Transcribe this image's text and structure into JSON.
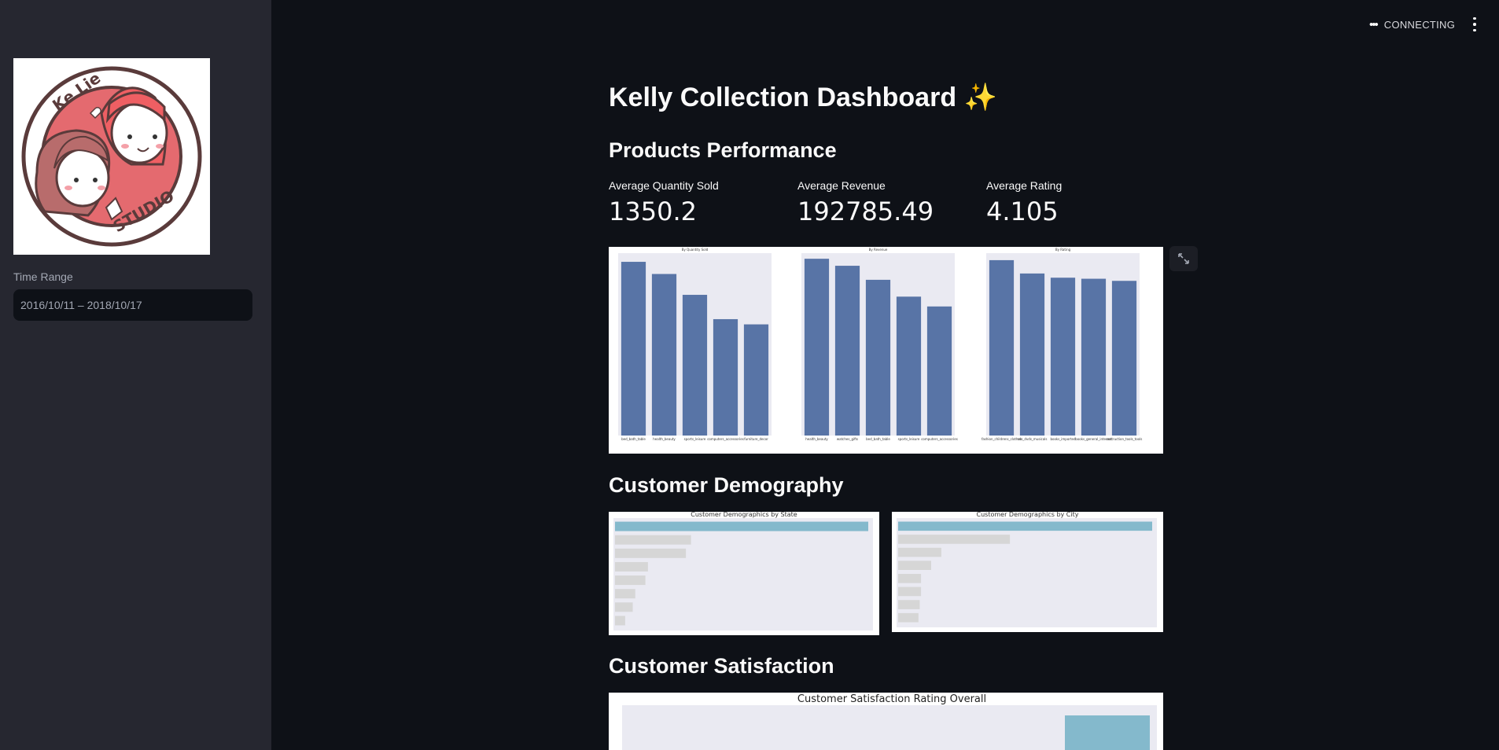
{
  "sidebar": {
    "logo_text": {
      "top": "Ke Lie",
      "bottom": "STUDIO"
    },
    "time_range_label": "Time Range",
    "time_range_value": "2016/10/11 – 2018/10/17"
  },
  "topbar": {
    "status": "CONNECTING"
  },
  "main": {
    "title": "Kelly Collection Dashboard ✨",
    "section_products": "Products Performance",
    "metrics": [
      {
        "label": "Average Quantity Sold",
        "value": "1350.2"
      },
      {
        "label": "Average Revenue",
        "value": "192785.49"
      },
      {
        "label": "Average Rating",
        "value": "4.105"
      }
    ],
    "section_customers": "Customer Demography",
    "section_satisfaction": "Customer Satisfaction"
  },
  "colors": {
    "bar_blue": "#5874a6",
    "bar_teal": "#84b9cc",
    "bar_gray": "#d6d6d6",
    "plot_bg": "#eaeaf2",
    "sidebar_bg": "#262730",
    "main_bg": "#0e1117"
  },
  "chart_data": [
    {
      "type": "bar",
      "title": "By Quantity Sold",
      "categories": [
        "bed_bath_table",
        "health_beauty",
        "sports_leisure",
        "computers_accessories",
        "furniture_decor"
      ],
      "values": [
        10000,
        9300,
        8100,
        6700,
        6400
      ],
      "ylim": [
        0,
        10500
      ]
    },
    {
      "type": "bar",
      "title": "By Revenue",
      "categories": [
        "health_beauty",
        "watches_gifts",
        "bed_bath_table",
        "sports_leisure",
        "computers_accessories"
      ],
      "values": [
        1.26,
        1.21,
        1.11,
        0.99,
        0.92
      ],
      "ylim": [
        0,
        1.3
      ]
    },
    {
      "type": "bar",
      "title": "By Rating",
      "categories": [
        "fashion_childrens_clothes",
        "cds_dvds_musicals",
        "books_imported",
        "books_general_interest",
        "costruction_tools_tools"
      ],
      "values": [
        5.0,
        4.62,
        4.5,
        4.47,
        4.41
      ],
      "ylim": [
        0,
        5.2
      ]
    },
    {
      "type": "bar",
      "orientation": "horizontal",
      "title": "Customer Demographics by State",
      "values": [
        100,
        30,
        28,
        13,
        12,
        8,
        7,
        4
      ]
    },
    {
      "type": "bar",
      "orientation": "horizontal",
      "title": "Customer Demographics by City",
      "values": [
        100,
        44,
        17,
        13,
        9,
        9,
        8.5,
        8
      ]
    },
    {
      "type": "bar",
      "title": "Customer Satisfaction Rating Overall",
      "values": [
        1
      ]
    }
  ]
}
